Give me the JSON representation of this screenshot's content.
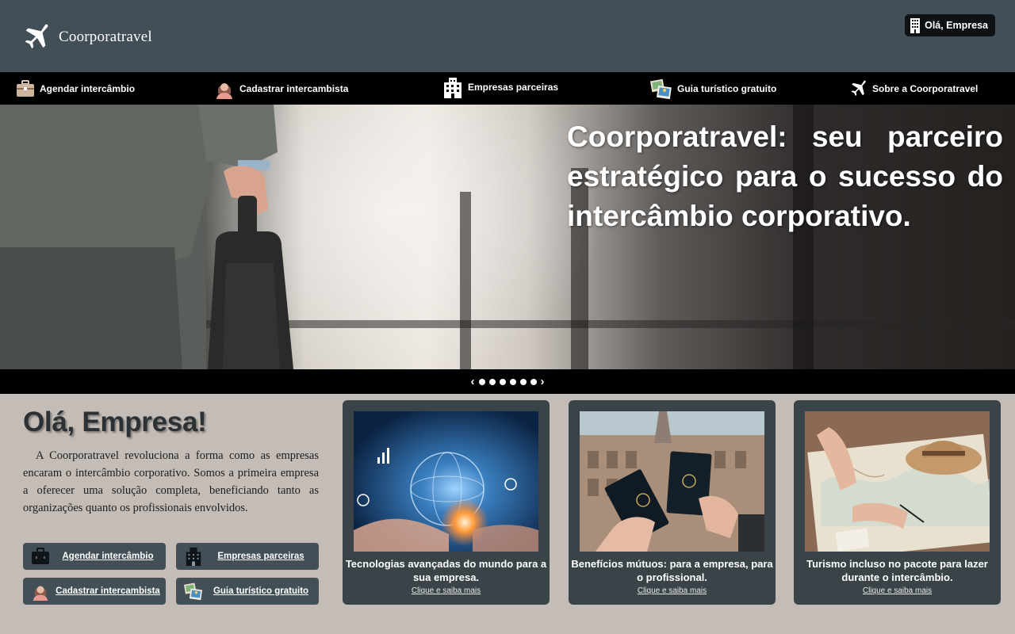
{
  "header": {
    "logo_text": "Coorporatravel",
    "user_badge": "Olá, Empresa"
  },
  "nav": {
    "items": [
      {
        "label": "Agendar intercâmbio",
        "icon": "briefcase-icon"
      },
      {
        "label": "Cadastrar intercambista",
        "icon": "person-icon"
      },
      {
        "label": "Empresas parceiras",
        "icon": "building-icon"
      },
      {
        "label": "Guia turístico gratuito",
        "icon": "photos-icon"
      },
      {
        "label": "Sobre a Coorporatravel",
        "icon": "airplane-icon"
      }
    ]
  },
  "hero": {
    "title": "Coorporatravel: seu parceiro estratégico para o sucesso do intercâmbio corporativo."
  },
  "carousel": {
    "prev": "‹",
    "next": "›",
    "dot_count": 6
  },
  "welcome": {
    "title": "Olá, Empresa!",
    "text": "A Coorporatravel revoluciona a forma como as empresas encaram o intercâmbio corporativo. Somos a primeira empresa a oferecer uma solução completa, beneficiando tanto as organizações quanto os profissionais envolvidos."
  },
  "quick_buttons": [
    {
      "label": "Agendar intercâmbio",
      "icon": "briefcase-icon"
    },
    {
      "label": "Empresas parceiras",
      "icon": "building-icon"
    },
    {
      "label": "Cadastrar intercambista",
      "icon": "person-icon"
    },
    {
      "label": "Guia turístico gratuito",
      "icon": "photos-icon"
    }
  ],
  "cards": [
    {
      "title": "Tecnologias avançadas do mundo para a sua empresa.",
      "link": "Clique e saiba mais"
    },
    {
      "title": "Benefícios mútuos: para a empresa, para o profissional.",
      "link": "Clique e saiba mais"
    },
    {
      "title": "Turismo incluso no pacote para lazer durante o intercâmbio.",
      "link": "Clique e saiba mais"
    }
  ],
  "colors": {
    "header_bg": "#434f56",
    "nav_bg": "#000000",
    "page_bg": "#c4bcb6",
    "card_bg": "#3a4448"
  }
}
